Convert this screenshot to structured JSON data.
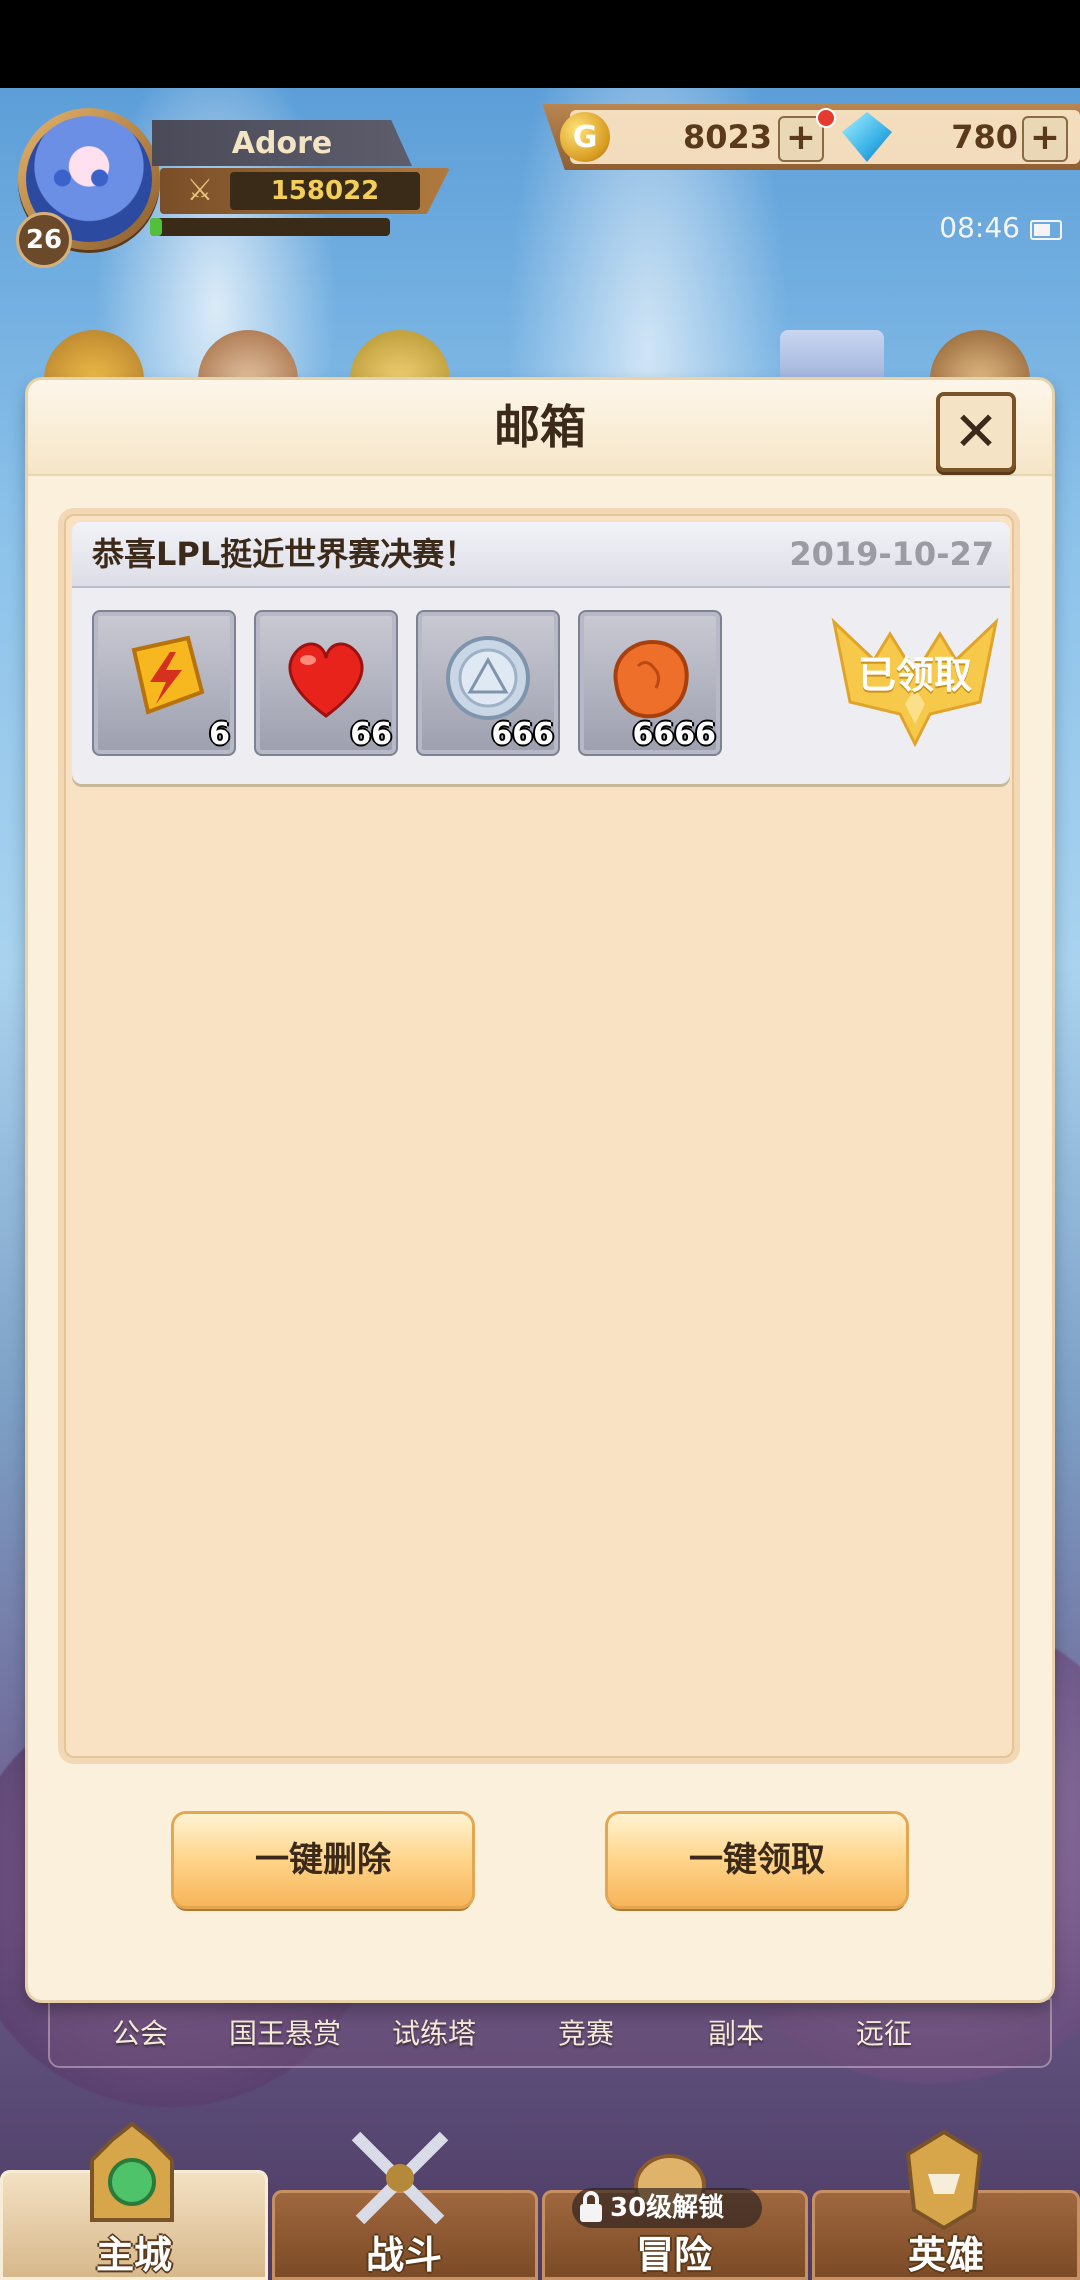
{
  "hud": {
    "player_name": "Adore",
    "level": "26",
    "power": "158022",
    "exp_progress": 0.05,
    "gold": "8023",
    "gems": "780",
    "clock": "08:46"
  },
  "mailbox": {
    "title": "邮箱",
    "mail": {
      "subject": "恭喜LPL挺近世界赛决赛！",
      "date": "2019-10-27",
      "rewards": [
        {
          "icon": "lightning-rune-icon",
          "qty": "6"
        },
        {
          "icon": "heart-icon",
          "qty": "66"
        },
        {
          "icon": "silver-coin-icon",
          "qty": "666"
        },
        {
          "icon": "orange-ore-icon",
          "qty": "6666"
        }
      ],
      "status": "已领取"
    },
    "delete_all_label": "一键删除",
    "claim_all_label": "一键领取"
  },
  "background_menu": [
    "公会",
    "国王悬赏",
    "试练塔",
    "竞赛",
    "副本",
    "远征"
  ],
  "bottom_nav": {
    "tabs": [
      "主城",
      "战斗",
      "冒险",
      "英雄"
    ],
    "active": "主城",
    "lock_text": "30级解锁"
  },
  "colors": {
    "modal_bg": "#fbf0dc",
    "panel_bg": "#f8e2c3",
    "button_gold": "#ffd48a",
    "text_dark": "#3b2a1a",
    "date_gray": "#9a9ba3"
  }
}
